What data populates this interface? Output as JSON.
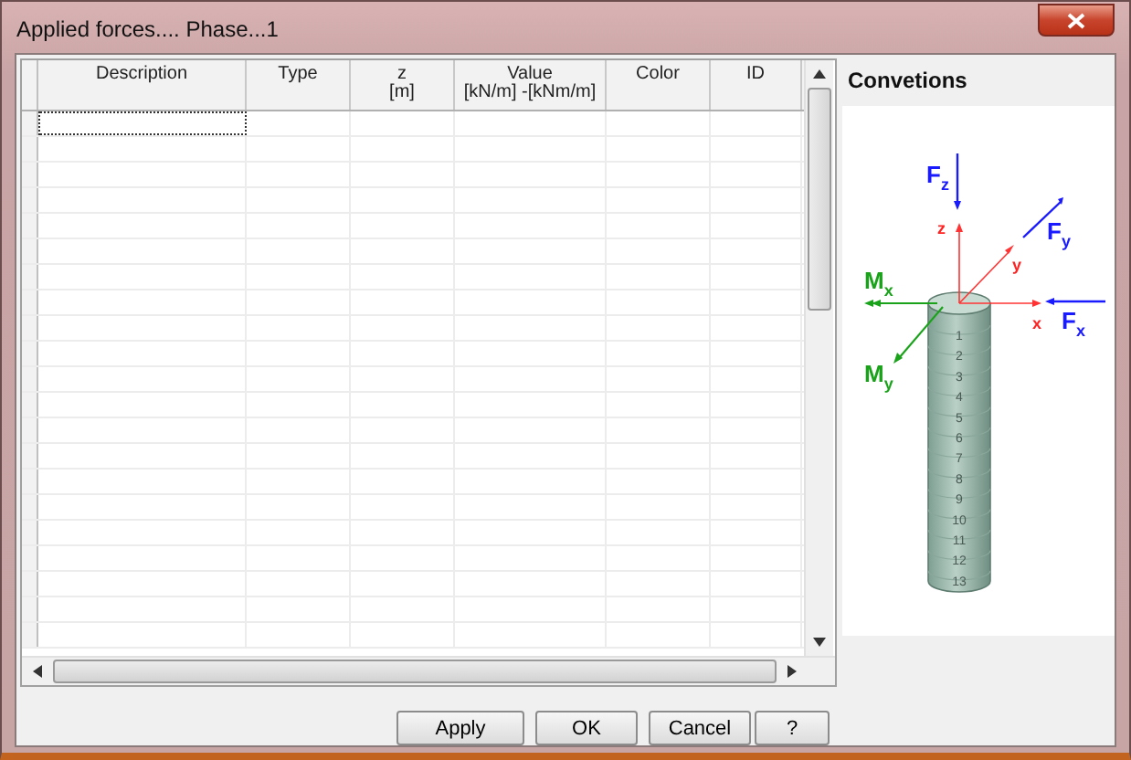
{
  "window": {
    "title": "Applied forces.... Phase...1"
  },
  "table": {
    "columns": [
      {
        "label": "Description"
      },
      {
        "label": "Type"
      },
      {
        "label": "z",
        "unit": "[m]"
      },
      {
        "label": "Value",
        "unit": "[kN/m] -[kNm/m]"
      },
      {
        "label": "Color"
      },
      {
        "label": "ID"
      }
    ]
  },
  "conventions": {
    "title": "Convetions",
    "force_labels": [
      {
        "kind": "fz",
        "main": "F",
        "sub": "z"
      },
      {
        "kind": "fy",
        "main": "F",
        "sub": "y"
      },
      {
        "kind": "fx",
        "main": "F",
        "sub": "x"
      },
      {
        "kind": "mx",
        "main": "M",
        "sub": "x"
      },
      {
        "kind": "my",
        "main": "M",
        "sub": "y"
      }
    ],
    "axis_labels": [
      "z",
      "y",
      "x"
    ],
    "segments": [
      "1",
      "2",
      "3",
      "4",
      "5",
      "6",
      "7",
      "8",
      "9",
      "10",
      "11",
      "12",
      "13"
    ]
  },
  "buttons": [
    "Apply",
    "OK",
    "Cancel",
    "?"
  ]
}
